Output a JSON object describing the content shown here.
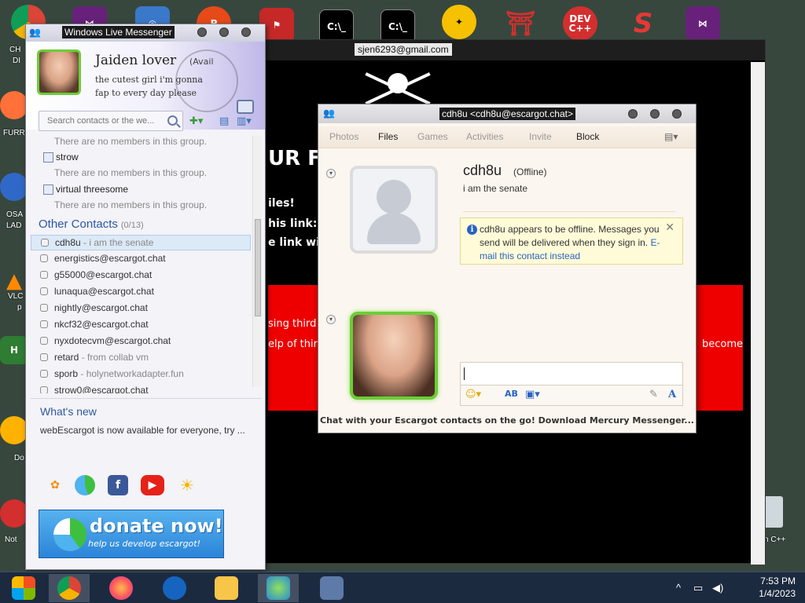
{
  "desktop": {
    "left_labels": [
      "CH",
      "DI",
      "FURR",
      "OSA",
      "LAD",
      "VLC",
      "p",
      "Do",
      "Not"
    ],
    "right_label": "n C++",
    "devcpp_label": "DEV\nC++"
  },
  "browser": {
    "email": "sjen6293@gmail.com",
    "frag_1": "UR FI",
    "frag_2": "iles!",
    "frag_3": "his link: ",
    "frag_4": "e link wi",
    "frag_5": "sing third p",
    "frag_6": "elp of third",
    "frag_7": "become"
  },
  "messenger": {
    "title": "Windows Live Messenger",
    "display_name": "Jaiden lover",
    "status": "(Avail",
    "psm_1": "the cutest girl i'm gonna",
    "psm_2": "fap to every day please",
    "search_placeholder": "Search contacts or the we...",
    "groups": [
      {
        "name": "",
        "empty": "There are no members in this group."
      },
      {
        "name": "strow",
        "empty": "There are no members in this group."
      },
      {
        "name": "virtual threesome",
        "empty": "There are no members in this group."
      }
    ],
    "other_contacts_label": "Other Contacts",
    "other_contacts_count": "(0/13)",
    "contacts": [
      {
        "name": "cdh8u",
        "msg": " - i am the senate"
      },
      {
        "name": "energistics@escargot.chat",
        "msg": ""
      },
      {
        "name": "g55000@escargot.chat",
        "msg": ""
      },
      {
        "name": "lunaqua@escargot.chat",
        "msg": ""
      },
      {
        "name": "nightly@escargot.chat",
        "msg": ""
      },
      {
        "name": "nkcf32@escargot.chat",
        "msg": ""
      },
      {
        "name": "nyxdotecvm@escargot.chat",
        "msg": ""
      },
      {
        "name": "retard",
        "msg": " - from collab vm"
      },
      {
        "name": "sporb",
        "msg": " - holynetworkadapter.fun"
      },
      {
        "name": "strow0@escargot.chat",
        "msg": ""
      }
    ],
    "whats_new_title": "What's new",
    "whats_new_text": "webEscargot is now available for everyone, try ...",
    "donate_title": "donate now!",
    "donate_sub": "help us develop escargot!"
  },
  "chat": {
    "title": "cdh8u <cdh8u@escargot.chat>",
    "toolbar": [
      "Photos",
      "Files",
      "Games",
      "Activities",
      "Invite",
      "Block"
    ],
    "contact_name": "cdh8u",
    "contact_status": "(Offline)",
    "contact_psm": "i am the senate",
    "notice_text": "cdh8u appears to be offline. Messages you send will be delivered when they sign in. ",
    "notice_link": "E-mail this contact instead",
    "footer": "Chat with your Escargot contacts on the go! Download Mercury Messenger..."
  },
  "taskbar": {
    "time": "7:53 PM",
    "date": "1/4/2023"
  },
  "colors": {
    "accent_green": "#6ccd37",
    "link_blue": "#2a62c2",
    "taskbar": "#1c2a40"
  }
}
